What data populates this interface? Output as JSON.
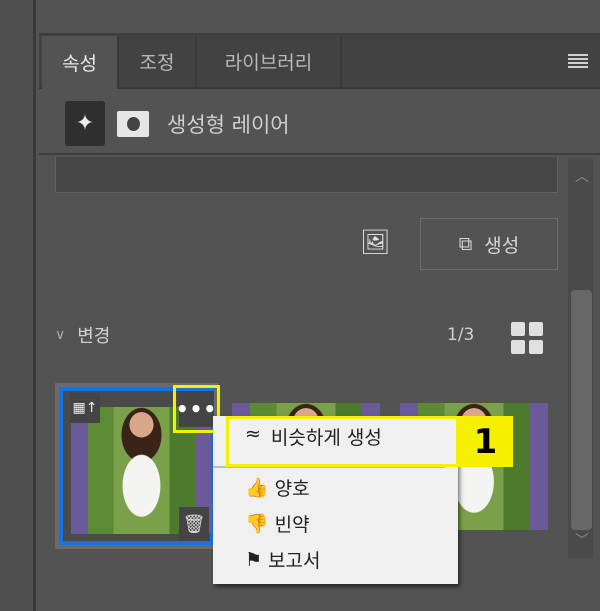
{
  "tabs": [
    {
      "label": "속성"
    },
    {
      "label": "조정"
    },
    {
      "label": "라이브러리"
    }
  ],
  "layer": {
    "title": "생성형 레이어"
  },
  "generate_button": "생성",
  "variations": {
    "header": "변경",
    "count": "1/3"
  },
  "context_menu": {
    "similar": "비슷하게 생성",
    "good": "양호",
    "poor": "빈약",
    "report": "보고서"
  },
  "annotation": {
    "badge": "1"
  },
  "colors": {
    "selection": "#1473e6",
    "highlight": "#f5ef00"
  }
}
